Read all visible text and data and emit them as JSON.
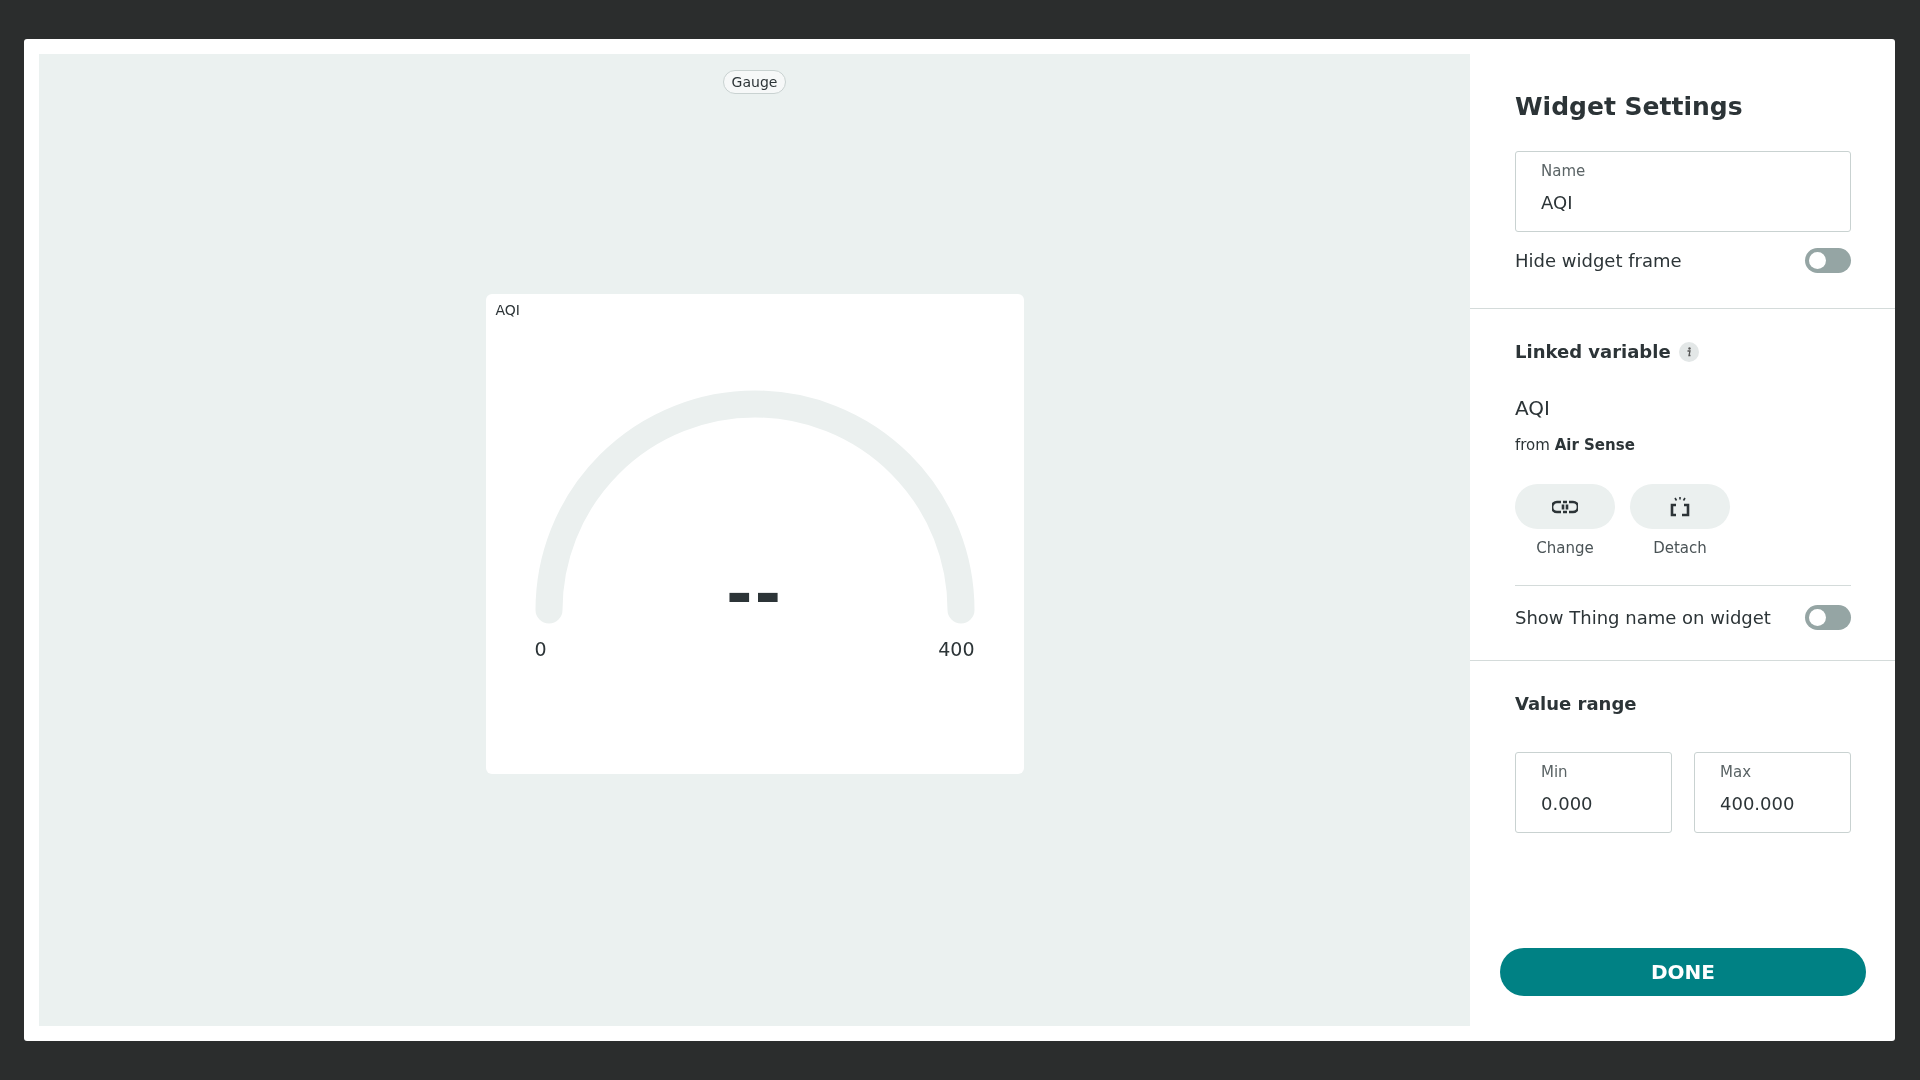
{
  "canvas": {
    "widget_type": "Gauge",
    "widget": {
      "title": "AQI",
      "value": "--",
      "min_label": "0",
      "max_label": "400"
    }
  },
  "settings": {
    "title": "Widget Settings",
    "name_field": {
      "label": "Name",
      "value": "AQI"
    },
    "hide_frame": {
      "label": "Hide widget frame",
      "on": false
    },
    "linked_variable": {
      "heading": "Linked variable",
      "variable": "AQI",
      "source": "from **Air Sense**",
      "actions": [
        {
          "kind": "change",
          "label": "Change"
        },
        {
          "kind": "detach",
          "label": "Detach"
        }
      ]
    },
    "show_thing_name": {
      "label": "Show Thing name on widget",
      "on": false
    },
    "value_range": {
      "heading": "Value range",
      "min": {
        "label": "Min",
        "value": "0.000"
      },
      "max": {
        "label": "Max",
        "value": "400.000"
      }
    },
    "done_button": "DONE"
  }
}
